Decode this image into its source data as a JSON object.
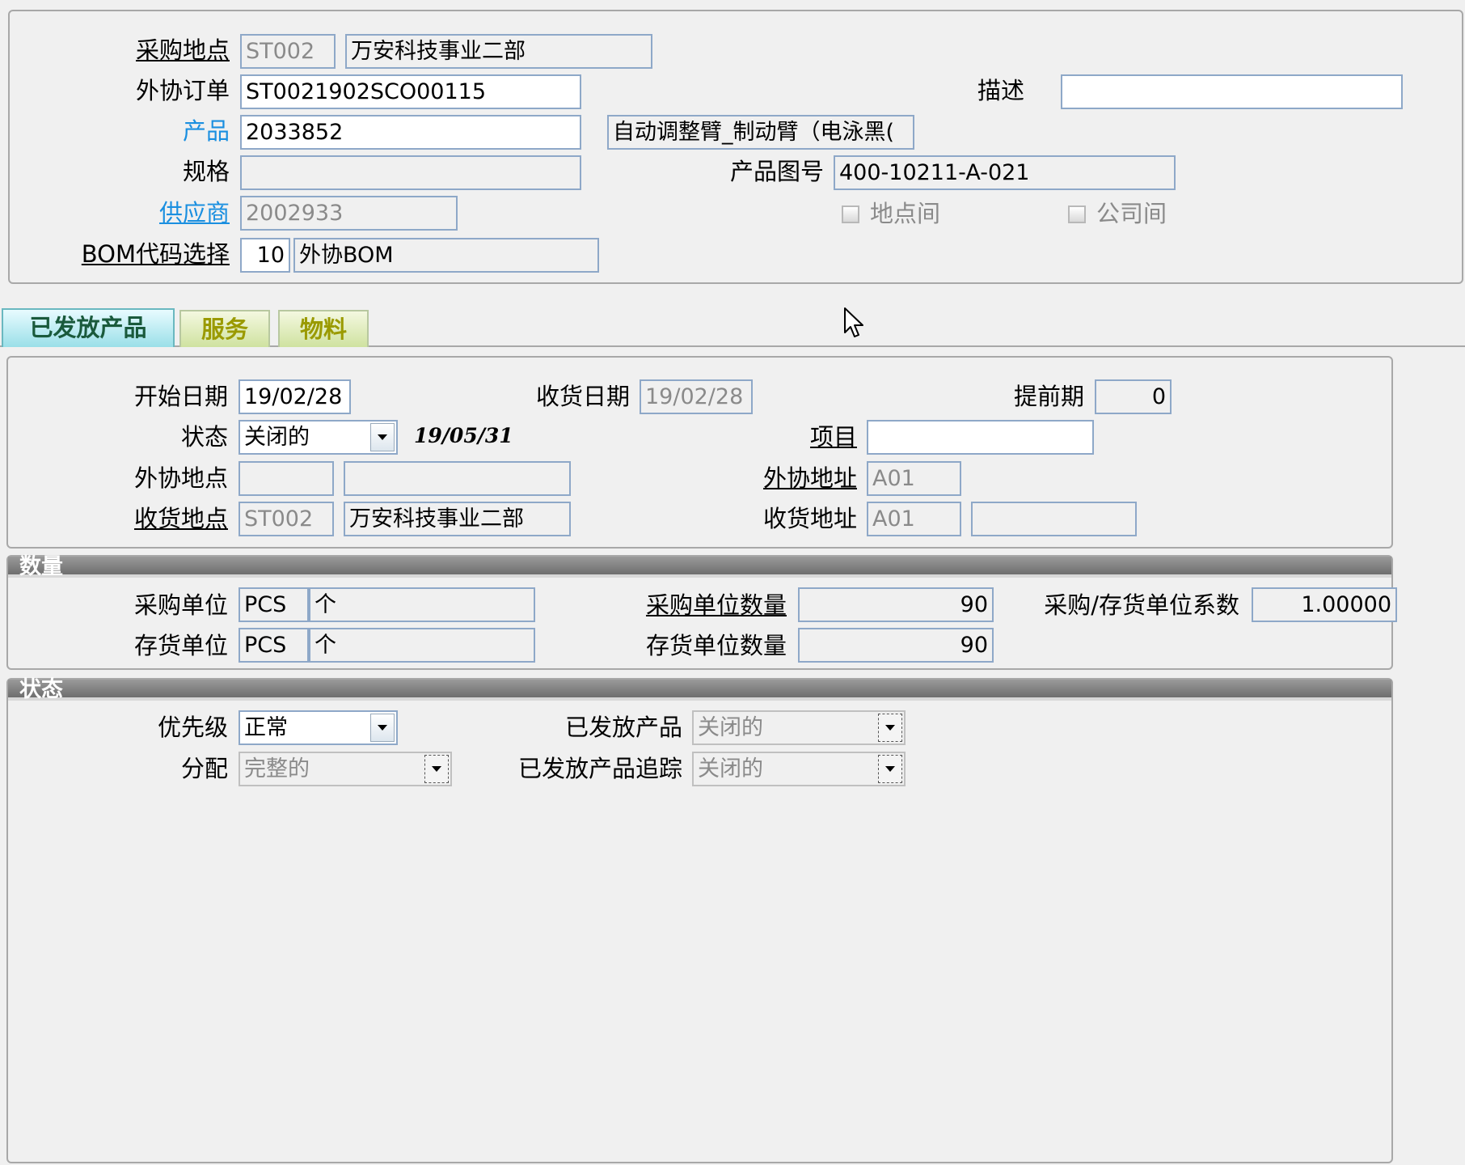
{
  "header": {
    "purchase_site": {
      "label": "采购地点",
      "code": "ST002",
      "name": "万安科技事业二部"
    },
    "subcontract_order": {
      "label": "外协订单",
      "value": "ST0021902SCO00115"
    },
    "description": {
      "label": "描述",
      "value": ""
    },
    "product": {
      "label": "产品",
      "code": "2033852",
      "name": "自动调整臂_制动臂（电泳黑("
    },
    "spec": {
      "label": "规格",
      "value": ""
    },
    "drawing_no": {
      "label": "产品图号",
      "value": "400-10211-A-021"
    },
    "supplier": {
      "label": "供应商",
      "value": "2002933"
    },
    "inter_site": {
      "label": "地点间",
      "checked": false
    },
    "inter_company": {
      "label": "公司间",
      "checked": false
    },
    "bom": {
      "label": "BOM代码选择",
      "code": "10",
      "name": "外协BOM"
    }
  },
  "tabs": [
    {
      "label": "已发放产品",
      "active": true
    },
    {
      "label": "服务",
      "active": false
    },
    {
      "label": "物料",
      "active": false
    }
  ],
  "released": {
    "start_date": {
      "label": "开始日期",
      "value": "19/02/28"
    },
    "receive_date": {
      "label": "收货日期",
      "value": "19/02/28"
    },
    "lead_time": {
      "label": "提前期",
      "value": "0"
    },
    "status": {
      "label": "状态",
      "value": "关闭的",
      "date": "19/05/31"
    },
    "project": {
      "label": "项目",
      "value": ""
    },
    "sub_site": {
      "label": "外协地点",
      "code": "",
      "name": ""
    },
    "sub_address": {
      "label": "外协地址",
      "value": "A01"
    },
    "receive_site": {
      "label": "收货地点",
      "code": "ST002",
      "name": "万安科技事业二部"
    },
    "receive_address": {
      "label": "收货地址",
      "value": "A01",
      "extra": ""
    }
  },
  "quantity": {
    "title": "数量",
    "purchase_unit": {
      "label": "采购单位",
      "code": "PCS",
      "name": "个"
    },
    "purchase_qty": {
      "label": "采购单位数量",
      "value": "90"
    },
    "conversion": {
      "label": "采购/存货单位系数",
      "value": "1.00000"
    },
    "stock_unit": {
      "label": "存货单位",
      "code": "PCS",
      "name": "个"
    },
    "stock_qty": {
      "label": "存货单位数量",
      "value": "90"
    }
  },
  "status_section": {
    "title": "状态",
    "priority": {
      "label": "优先级",
      "value": "正常"
    },
    "released_product": {
      "label": "已发放产品",
      "value": "关闭的"
    },
    "allocation": {
      "label": "分配",
      "value": "完整的"
    },
    "released_tracking": {
      "label": "已发放产品追踪",
      "value": "关闭的"
    }
  },
  "icons": {
    "cursor": "mouse-pointer-icon",
    "dropdown": "chevron-down-icon"
  }
}
